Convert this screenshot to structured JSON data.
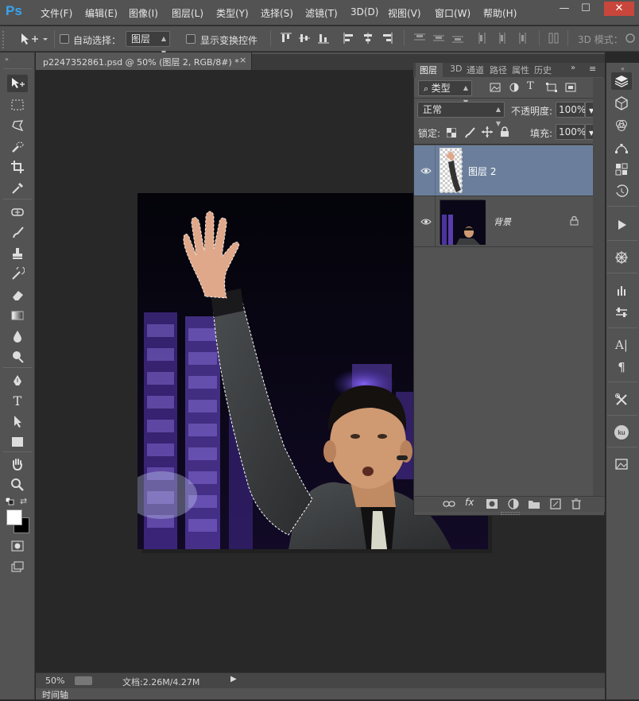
{
  "app": {
    "logo": "Ps",
    "menus": [
      "文件(F)",
      "编辑(E)",
      "图像(I)",
      "图层(L)",
      "类型(Y)",
      "选择(S)",
      "滤镜(T)",
      "3D(D)",
      "视图(V)",
      "窗口(W)",
      "帮助(H)"
    ],
    "window_controls": [
      "—",
      "☐",
      "✕"
    ]
  },
  "options": {
    "auto_select_label": "自动选择：",
    "auto_select_value": "图层",
    "show_transform_label": "显示变换控件",
    "mode_3d_label": "3D 模式："
  },
  "document": {
    "tab_title": "p2247352861.psd @ 50% (图层 2, RGB/8#) *",
    "tab_close": "×"
  },
  "status": {
    "zoom": "50%",
    "doc_info": "文档:2.26M/4.27M",
    "timeline_label": "时间轴"
  },
  "layers_panel": {
    "tabs": [
      "图层",
      "3D",
      "通道",
      "路径",
      "属性",
      "历史"
    ],
    "filter_label": "类型",
    "blend_mode": "正常",
    "opacity_label": "不透明度:",
    "opacity_value": "100%",
    "lock_label": "锁定:",
    "fill_label": "填充:",
    "fill_value": "100%",
    "layers": [
      {
        "name": "图层 2",
        "selected": true,
        "visible": true
      },
      {
        "name": "背景",
        "selected": false,
        "visible": true,
        "locked": true
      }
    ],
    "footer_fx": "fx"
  },
  "colors": {
    "accent_selection": "#6b7f9c",
    "ps_blue": "#38a4f0",
    "panel_bg": "#535353"
  }
}
